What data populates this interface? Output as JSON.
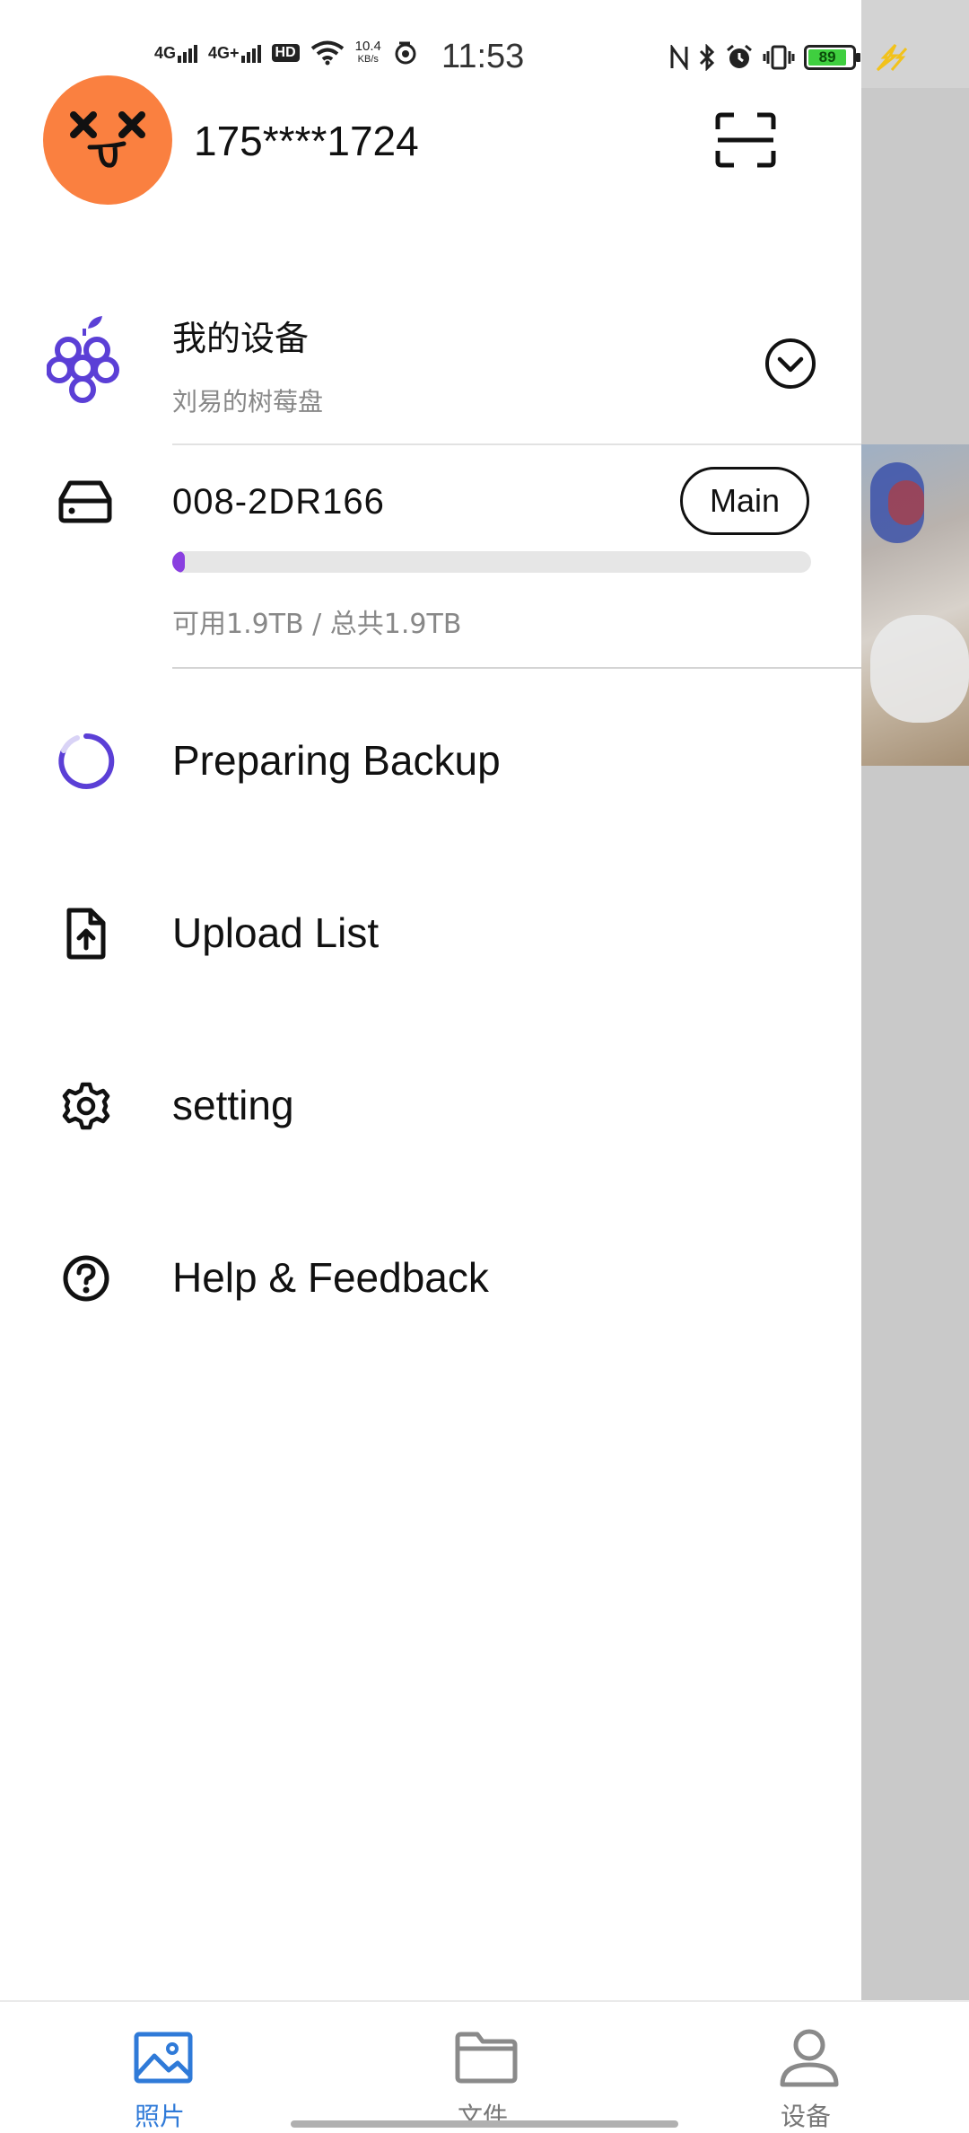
{
  "status_bar": {
    "net1": "4G",
    "net2": "4G+",
    "hd": "HD",
    "speed_value": "10.4",
    "speed_unit": "KB/s",
    "time": "11:53",
    "battery": "89"
  },
  "header": {
    "phone": "175****1724"
  },
  "device": {
    "title": "我的设备",
    "subtitle": "刘易的树莓盘"
  },
  "disk": {
    "name": "008-2DR166",
    "badge": "Main",
    "used_fraction": 0.02,
    "storage_text": "可用1.9TB / 总共1.9TB"
  },
  "menu": [
    {
      "label": "Preparing Backup",
      "icon": "loading-spinner-icon"
    },
    {
      "label": "Upload List",
      "icon": "file-upload-icon"
    },
    {
      "label": "setting",
      "icon": "gear-icon"
    },
    {
      "label": "Help & Feedback",
      "icon": "help-circle-icon"
    }
  ],
  "bottom_nav": [
    {
      "label": "照片",
      "icon": "image-icon",
      "active": true
    },
    {
      "label": "文件",
      "icon": "folder-icon",
      "active": false
    },
    {
      "label": "设备",
      "icon": "person-icon",
      "active": false
    }
  ],
  "colors": {
    "accent": "#5b3fd6",
    "active_tab": "#2f7ad8",
    "avatar_bg": "#fa8040",
    "progress": "#8a3fe0"
  }
}
